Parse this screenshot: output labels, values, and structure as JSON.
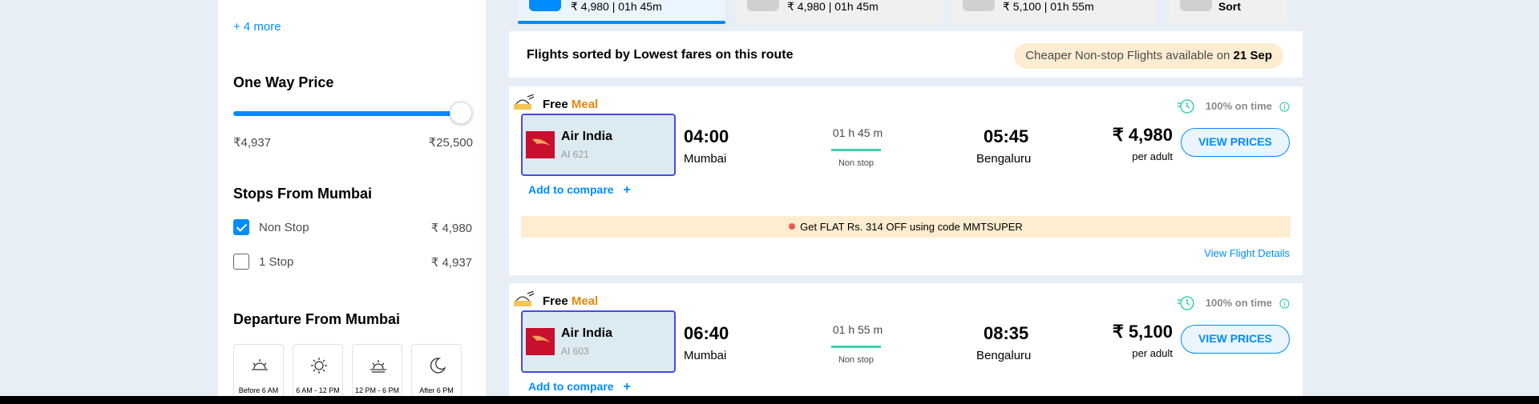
{
  "sidebar": {
    "more_link": "+ 4 more",
    "one_way_title": "One Way Price",
    "price_min": "₹4,937",
    "price_max": "₹25,500",
    "price_slider_fraction": 1.0,
    "stops_title": "Stops From Mumbai",
    "stops": [
      {
        "label": "Non Stop",
        "price": "₹ 4,980",
        "checked": true
      },
      {
        "label": "1 Stop",
        "price": "₹ 4,937",
        "checked": false
      }
    ],
    "departure_title": "Departure From Mumbai",
    "departure_slots": [
      {
        "label": "Before 6 AM",
        "icon": "sunrise-icon"
      },
      {
        "label": "6 AM - 12 PM",
        "icon": "sun-icon"
      },
      {
        "label": "12 PM - 6 PM",
        "icon": "sunset-icon"
      },
      {
        "label": "After 6 PM",
        "icon": "moon-icon"
      }
    ]
  },
  "tabs": [
    {
      "text": "₹ 4,980 | 01h 45m",
      "active": true
    },
    {
      "text": "₹ 4,980 | 01h 45m",
      "active": false
    },
    {
      "text": "₹ 5,100 | 01h 55m",
      "active": false
    },
    {
      "text": "Sort",
      "active": false
    }
  ],
  "sorted": {
    "text": "Flights sorted by Lowest fares on this route",
    "cheaper_prefix": "Cheaper Non-stop Flights available on",
    "cheaper_date": "21 Sep"
  },
  "flights": [
    {
      "meal_free": "Free",
      "meal_word": "Meal",
      "ontime": "100% on time",
      "airline": "Air India",
      "flight_no": "AI 621",
      "dep_time": "04:00",
      "dep_city": "Mumbai",
      "duration": "01 h 45 m",
      "stops": "Non stop",
      "arr_time": "05:45",
      "arr_city": "Bengaluru",
      "price": "₹ 4,980",
      "per_adult": "per adult",
      "view_prices": "VIEW PRICES",
      "compare": "Add to compare",
      "offer": "Get FLAT Rs. 314 OFF using code MMTSUPER",
      "details": "View Flight Details"
    },
    {
      "meal_free": "Free",
      "meal_word": "Meal",
      "ontime": "100% on time",
      "airline": "Air India",
      "flight_no": "AI 603",
      "dep_time": "06:40",
      "dep_city": "Mumbai",
      "duration": "01 h 55 m",
      "stops": "Non stop",
      "arr_time": "08:35",
      "arr_city": "Bengaluru",
      "price": "₹ 5,100",
      "per_adult": "per adult",
      "view_prices": "VIEW PRICES",
      "compare": "Add to compare"
    }
  ],
  "colors": {
    "accent": "#008cff",
    "meal": "#e8860c",
    "airline_red": "#c8102e",
    "duration_line": "#3ed2b0",
    "offer_bg": "#ffedd1"
  }
}
